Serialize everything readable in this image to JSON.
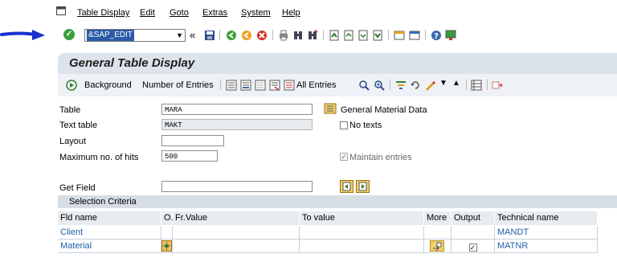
{
  "menu": {
    "items": [
      "Table Display",
      "Edit",
      "Goto",
      "Extras",
      "System",
      "Help"
    ]
  },
  "command_field": {
    "value": "&SAP_EDIT"
  },
  "screen": {
    "title": "General Table Display"
  },
  "app_toolbar": {
    "background_label": "Background",
    "number_of_entries_label": "Number of Entries",
    "all_entries_label": "All Entries"
  },
  "form": {
    "table_label": "Table",
    "table_value": "MARA",
    "table_desc": "General Material Data",
    "text_table_label": "Text table",
    "text_table_value": "MAKT",
    "no_texts_label": "No texts",
    "no_texts_checked": false,
    "layout_label": "Layout",
    "layout_value": "",
    "max_hits_label": "Maximum no. of hits",
    "max_hits_value": "500",
    "maintain_entries_label": "Maintain entries",
    "maintain_entries_checked": true,
    "get_field_label": "Get Field",
    "get_field_value": ""
  },
  "selection": {
    "header": "Selection Criteria",
    "columns": [
      "Fld name",
      "O.",
      "Fr.Value",
      "To value",
      "More",
      "Output",
      "Technical name"
    ],
    "rows": [
      {
        "fld_name": "Client",
        "fr_value": "",
        "to_value": "",
        "output": "",
        "technical_name": "MANDT"
      },
      {
        "fld_name": "Material",
        "fr_value": "",
        "to_value": "",
        "output": "✓",
        "technical_name": "MATNR"
      }
    ]
  },
  "colors": {
    "header_bg": "#dde3ea",
    "toolbar_bg": "#eef1f5",
    "link": "#1f5fa8",
    "annotation_arrow": "#1a2fd0"
  }
}
